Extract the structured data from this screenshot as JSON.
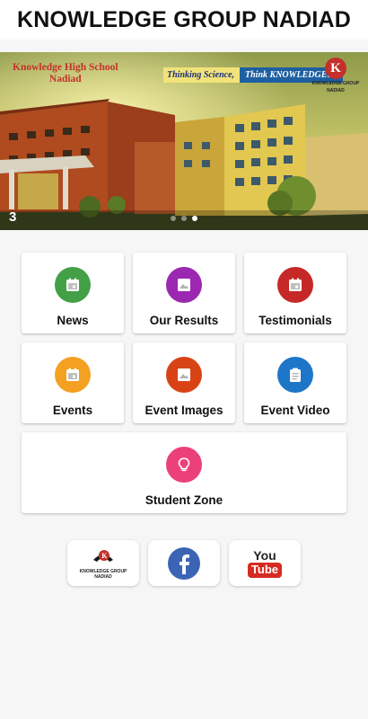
{
  "header": {
    "title": "KNOWLEDGE GROUP NADIAD"
  },
  "banner": {
    "school_name_line1": "Knowledge High School",
    "school_name_line2": "Nadiad",
    "tagline_left": "Thinking Science,",
    "tagline_right": "Think KNOWLEDGE!!!",
    "logo_letter": "K",
    "logo_text": "KNOWLEDGE GROUP",
    "logo_subtext": "NADIAD",
    "slide_counter": "3",
    "slide_count": 3,
    "active_slide_index": 2
  },
  "tiles": [
    {
      "id": "news",
      "label": "News",
      "icon": "calendar-icon",
      "color": "#43a047"
    },
    {
      "id": "our-results",
      "label": "Our Results",
      "icon": "image-icon",
      "color": "#9c27b0"
    },
    {
      "id": "testimonials",
      "label": "Testimonials",
      "icon": "calendar-icon",
      "color": "#c62828"
    },
    {
      "id": "events",
      "label": "Events",
      "icon": "calendar-icon",
      "color": "#f4a020"
    },
    {
      "id": "event-images",
      "label": "Event Images",
      "icon": "image-icon",
      "color": "#d84315"
    },
    {
      "id": "event-video",
      "label": "Event Video",
      "icon": "clipboard-icon",
      "color": "#1e76c8"
    },
    {
      "id": "student-zone",
      "label": "Student Zone",
      "icon": "lightbulb-icon",
      "color": "#ec407a"
    }
  ],
  "social": {
    "logo_text": "KNOWLEDGE GROUP",
    "logo_subtext": "NADIAD",
    "facebook_color": "#3b64b4",
    "youtube_top": "You",
    "youtube_bottom": "Tube"
  }
}
